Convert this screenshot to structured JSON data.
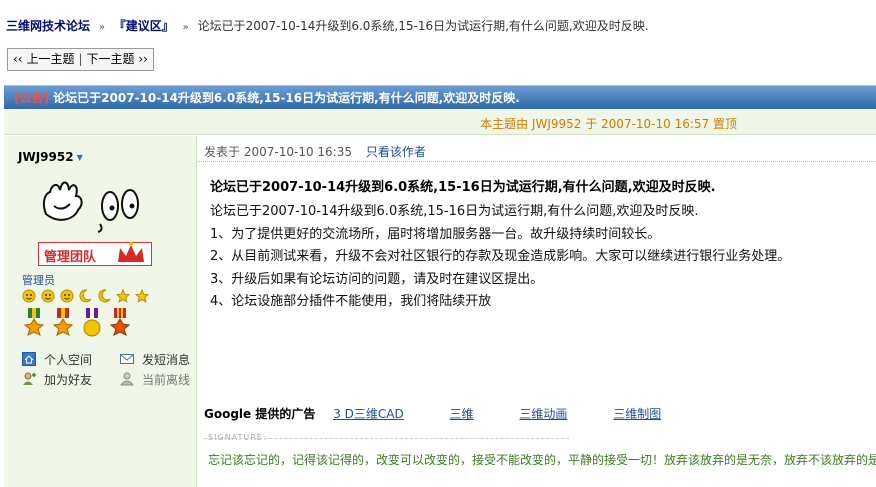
{
  "breadcrumb": {
    "forum": "三维网技术论坛",
    "section": "『建议区』",
    "separator": "»",
    "current": "论坛已于2007-10-14升级到6.0系统,15-16日为试运行期,有什么问题,欢迎及时反映."
  },
  "thread_nav": {
    "prev_arrows": "‹‹",
    "prev": "上一主题",
    "next": "下一主题",
    "next_arrows": "››"
  },
  "title_bar": {
    "tag": "[公告]",
    "title": "论坛已于2007-10-14升级到6.0系统,15-16日为试运行期,有什么问题,欢迎及时反映."
  },
  "thread_info": "本主题由 JWJ9952 于 2007-10-10 16:57 置顶",
  "author": {
    "name": "JWJ9952",
    "badge_text": "管理团队",
    "role": "管理员",
    "actions": [
      {
        "label": "个人空间",
        "icon": "home-icon"
      },
      {
        "label": "发短消息",
        "icon": "envelope-icon"
      },
      {
        "label": "加为好友",
        "icon": "add-friend-icon"
      },
      {
        "label": "当前离线",
        "icon": "offline-user-icon"
      }
    ]
  },
  "post": {
    "meta_prefix": "发表于",
    "posted_at": "2007-10-10 16:35",
    "only_author": "只看该作者",
    "title": "论坛已于2007-10-14升级到6.0系统,15-16日为试运行期,有什么问题,欢迎及时反映.",
    "lines": [
      "论坛已于2007-10-14升级到6.0系统,15-16日为试运行期,有什么问题,欢迎及时反映.",
      "1、为了提供更好的交流场所，届时将增加服务器一台。故升级持续时间较长。",
      "2、从目前测试来看，升级不会对社区银行的存款及现金造成影响。大家可以继续进行银行业务处理。",
      "3、升级后如果有论坛访问的问题，请及时在建议区提出。",
      "4、论坛设施部分插件不能使用，我们将陆续开放"
    ]
  },
  "ads": {
    "heading": "Google 提供的广告",
    "links": [
      "3 D三维CAD",
      "三维",
      "三维动画",
      "三维制图"
    ]
  },
  "signature": {
    "label": "SIGNATURE:",
    "text": "忘记该忘记的，记得该记得的，改变可以改变的，接受不能改变的，平静的接受一切！放弃该放弃的是无奈，放弃不该放弃的是"
  },
  "colors": {
    "title_bar": "#2f69a9",
    "announce_tag": "#ff4a4a",
    "pin_info": "#d07a00",
    "sidebar_bg": "#f0f7e9",
    "link": "#1f4f9a",
    "signature": "#3a7d20"
  }
}
